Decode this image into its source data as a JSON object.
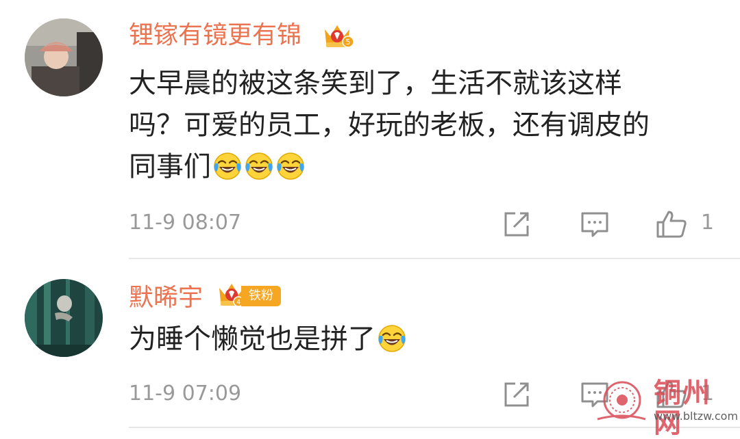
{
  "comments": [
    {
      "username": "锂镓有镜更有锦",
      "level": "5",
      "text_lines": [
        "大早晨的被这条笑到了，生活不就该这样",
        "吗？可爱的员工，好玩的老板，还有调皮的",
        "同事们"
      ],
      "emojis": [
        "laugh-cry-emoji",
        "laugh-cry-emoji",
        "laugh-cry-emoji"
      ],
      "time": "11-9 08:07",
      "likes": "1"
    },
    {
      "username": "默晞宇",
      "level": "4",
      "fan_tag": "铁粉",
      "text_lines": [
        "为睡个懒觉也是拼了"
      ],
      "emojis": [
        "laugh-cry-emoji"
      ],
      "time": "11-9 07:09",
      "likes": "1"
    }
  ],
  "icons": [
    "share-icon",
    "comment-icon",
    "like-icon",
    "crown-badge-icon"
  ],
  "colors": {
    "username": "#eb7350",
    "text": "#222222",
    "meta": "#999999",
    "badge": "#f5a623"
  },
  "watermark": {
    "title": "铜州网",
    "url": "www.bltzw.com"
  }
}
